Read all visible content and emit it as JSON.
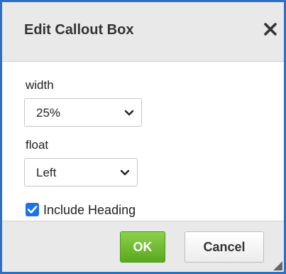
{
  "dialog": {
    "title": "Edit Callout Box",
    "close_icon": "close-icon"
  },
  "fields": {
    "width": {
      "label": "width",
      "value": "25%"
    },
    "float": {
      "label": "float",
      "value": "Left"
    }
  },
  "checkbox": {
    "label": "Include Heading",
    "checked": true
  },
  "buttons": {
    "ok": "OK",
    "cancel": "Cancel"
  },
  "colors": {
    "border": "#2f6fc0",
    "ok_button": "#6bbd2b",
    "checkbox": "#1a73e8",
    "header_bg": "#e9e9e9"
  },
  "icons": {
    "close": "close-icon",
    "dropdown": "chevron-down-icon",
    "checkmark": "checkmark-icon",
    "resize": "resize-grip-icon"
  }
}
